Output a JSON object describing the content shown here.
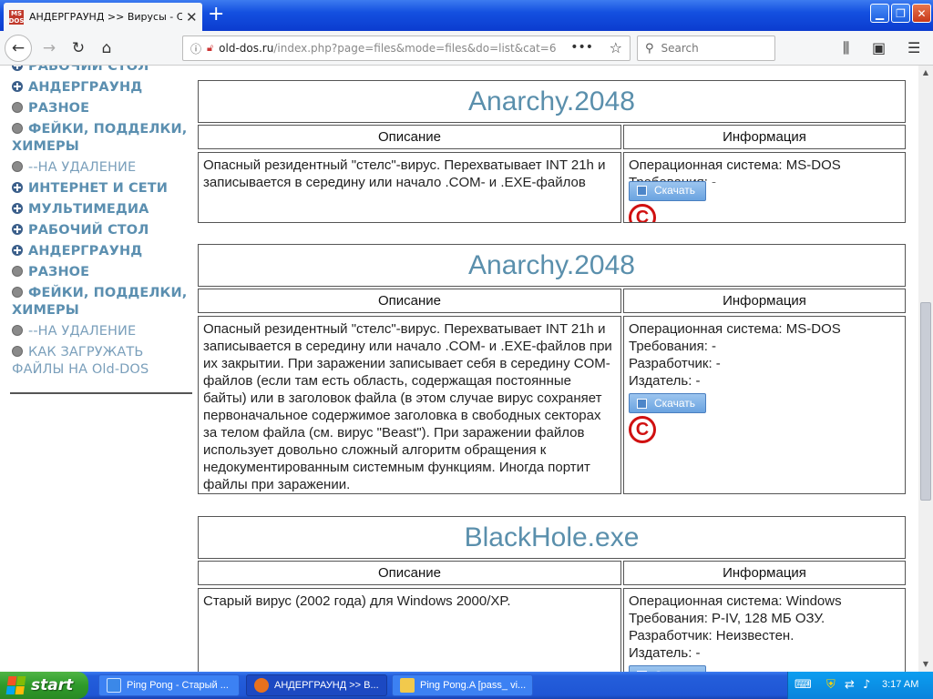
{
  "browser": {
    "tab_title": "АНДЕРГРАУНД >> Вирусы - Ста",
    "favicon_text": "MS DOS",
    "tab_close": "✕",
    "new_tab": "+",
    "url_host": "old-dos.ru",
    "url_path": "/index.php?page=files&mode=files&do=list&cat=6",
    "search_placeholder": "Search",
    "page_actions": "•••"
  },
  "sidebar_menu": [
    {
      "label": "РАБОЧИЙ СТОЛ",
      "bullet": "plus",
      "style": "bold"
    },
    {
      "label": "АНДЕРГРАУНД",
      "bullet": "plus",
      "style": "bold"
    },
    {
      "label": "РАЗНОЕ",
      "bullet": "dot",
      "style": "bold"
    },
    {
      "label": "ФЕЙКИ, ПОДДЕЛКИ, ХИМЕРЫ",
      "bullet": "dot",
      "style": "bold"
    },
    {
      "label": "--НА УДАЛЕНИЕ",
      "bullet": "dot",
      "style": "light"
    },
    {
      "label": "ИНТЕРНЕТ И СЕТИ",
      "bullet": "plus",
      "style": "bold"
    },
    {
      "label": "МУЛЬТИМЕДИА",
      "bullet": "plus",
      "style": "bold"
    },
    {
      "label": "РАБОЧИЙ СТОЛ",
      "bullet": "plus",
      "style": "bold"
    },
    {
      "label": "АНДЕРГРАУНД",
      "bullet": "plus",
      "style": "bold"
    },
    {
      "label": "РАЗНОЕ",
      "bullet": "dot",
      "style": "bold"
    },
    {
      "label": "ФЕЙКИ, ПОДДЕЛКИ, ХИМЕРЫ",
      "bullet": "dot",
      "style": "bold"
    },
    {
      "label": "--НА УДАЛЕНИЕ",
      "bullet": "dot",
      "style": "light"
    },
    {
      "label": "КАК ЗАГРУЖАТЬ ФАЙЛЫ НА Old-DOS",
      "bullet": "dot",
      "style": "light"
    }
  ],
  "files": [
    {
      "title": "Anarchy.2048",
      "desc_header": "Описание",
      "info_header": "Информация",
      "description": "Опасный резидентный \"стелс\"-вирус. Перехватывает INT 21h и записывается в середину или начало .COM- и .EXE-файлов",
      "info": [
        "Операционная система: MS-DOS",
        "Требования: -"
      ],
      "download_label": "Скачать",
      "copyright_symbol": "C"
    },
    {
      "title": "Anarchy.2048",
      "desc_header": "Описание",
      "info_header": "Информация",
      "description": "Опасный резидентный \"стелс\"-вирус. Перехватывает INT 21h и записывается в середину или начало .COM- и .EXE-файлов при их закрытии. При заражении записывает себя в середину COM-файлов (если там есть область, содержащая постоянные байты) или в заголовок файла (в этом случае вирус сохраняет первоначальное содержимое заголовка в свободных секторах за телом файла (см. вирус \"Beast\"). При заражении файлов использует довольно сложный алгоритм обращения к недокументированным системным функциям. Иногда портит файлы при заражении.",
      "info": [
        "Операционная система: MS-DOS",
        "Требования: -",
        "Разработчик: -",
        "Издатель: -"
      ],
      "download_label": "Скачать",
      "copyright_symbol": "C"
    },
    {
      "title": "BlackHole.exe",
      "desc_header": "Описание",
      "info_header": "Информация",
      "description": "Старый вирус (2002 года) для Windows 2000/XP.",
      "info": [
        "Операционная система: Windows",
        "Требования: P-IV, 128 МБ ОЗУ.",
        "Разработчик: Неизвестен.",
        "Издатель: -"
      ],
      "download_label": "Скачать",
      "copyright_symbol": ""
    }
  ],
  "taskbar": {
    "start_label": "start",
    "tasks": [
      {
        "label": "Ping Pong - Старый ...",
        "active": false
      },
      {
        "label": "АНДЕРГРАУНД >> В...",
        "active": true
      },
      {
        "label": "Ping Pong.A [pass_ vi...",
        "active": false
      }
    ],
    "clock": "3:17 AM"
  }
}
